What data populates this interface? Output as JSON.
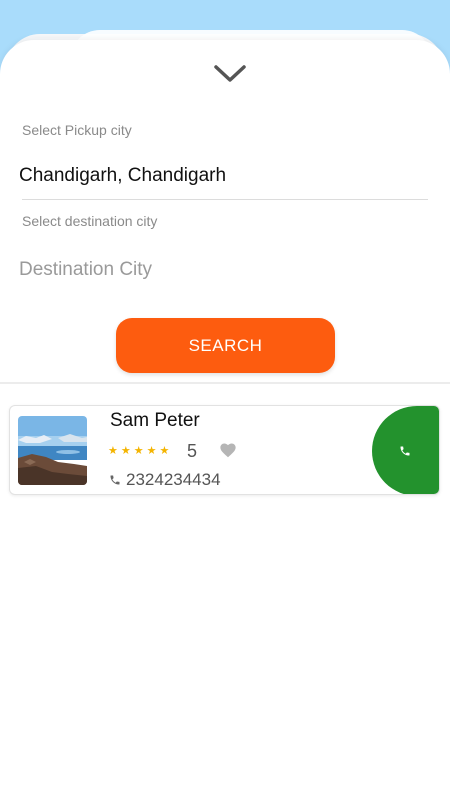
{
  "pickup": {
    "label": "Select Pickup city",
    "value": "Chandigarh, Chandigarh"
  },
  "destination": {
    "label": "Select destination city",
    "placeholder": "Destination City"
  },
  "search_button": {
    "label": "SEARCH"
  },
  "colors": {
    "accent": "#fd5c0f",
    "call": "#23922d",
    "sky": "#a9dcfb",
    "star": "#f4b400"
  },
  "drivers": [
    {
      "name": "Sam Peter",
      "rating": "5",
      "stars": 5,
      "phone": "2324234434",
      "icons": [
        "star-icon",
        "heart-icon",
        "phone-icon",
        "call-icon"
      ]
    }
  ]
}
